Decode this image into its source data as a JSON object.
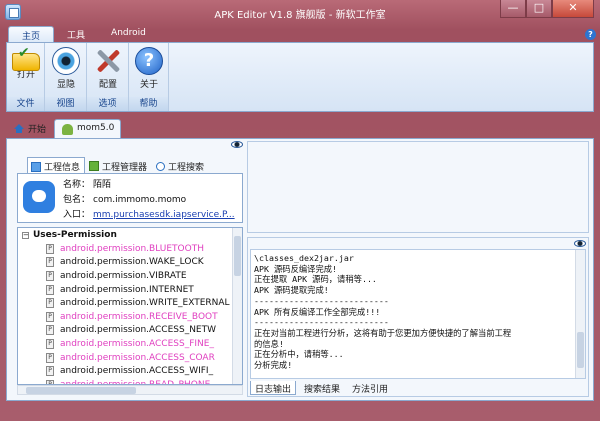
{
  "window": {
    "title": "APK Editor V1.8 旗舰版 - 新软工作室",
    "min": "—",
    "max": "□",
    "close": "✕"
  },
  "ribbon_tabs": [
    "主页",
    "工具",
    "Android"
  ],
  "help": "?",
  "ribbon": {
    "groups": [
      {
        "label": "文件",
        "buttons": [
          {
            "label": "打开",
            "icon": "folder-open-icon"
          }
        ]
      },
      {
        "label": "视图",
        "buttons": [
          {
            "label": "显隐",
            "icon": "eye-icon"
          }
        ]
      },
      {
        "label": "选项",
        "buttons": [
          {
            "label": "配置",
            "icon": "tools-icon"
          }
        ]
      },
      {
        "label": "帮助",
        "buttons": [
          {
            "label": "关于",
            "icon": "help-icon"
          }
        ]
      }
    ]
  },
  "doc_tabs": {
    "start": "开始",
    "active": "mom5.0"
  },
  "left_tabs": [
    "工程信息",
    "工程管理器",
    "工程搜索"
  ],
  "app_info": {
    "name_label": "名称：",
    "name": "陌陌",
    "package_label": "包名：",
    "package": "com.immomo.momo",
    "entry_label": "入口：",
    "entry": "mm.purchasesdk.iapservice.P..."
  },
  "permissions": {
    "header": "Uses-Permission",
    "items": [
      {
        "text": "android.permission.BLUETOOTH",
        "highlight": true
      },
      {
        "text": "android.permission.WAKE_LOCK",
        "highlight": false
      },
      {
        "text": "android.permission.VIBRATE",
        "highlight": false
      },
      {
        "text": "android.permission.INTERNET",
        "highlight": false
      },
      {
        "text": "android.permission.WRITE_EXTERNAL",
        "highlight": false
      },
      {
        "text": "android.permission.RECEIVE_BOOT",
        "highlight": true
      },
      {
        "text": "android.permission.ACCESS_NETW",
        "highlight": false
      },
      {
        "text": "android.permission.ACCESS_FINE_",
        "highlight": true
      },
      {
        "text": "android.permission.ACCESS_COAR",
        "highlight": true
      },
      {
        "text": "android.permission.ACCESS_WIFI_",
        "highlight": false
      },
      {
        "text": "android.permission.READ_PHONE",
        "highlight": true
      }
    ]
  },
  "log": {
    "lines": [
      "\\classes_dex2jar.jar",
      "APK 源码反编译完成!",
      "正在提取 APK 源码，请稍等...",
      "APK 源码提取完成!",
      "---------------------------",
      "APK 所有反编译工作全部完成!!!",
      "---------------------------",
      "正在对当前工程进行分析，这将有助于您更加方便快捷的了解当前工程",
      "的信息!",
      "正在分析中，请稍等...",
      "分析完成!"
    ]
  },
  "bottom_tabs": [
    "日志输出",
    "搜索结果",
    "方法引用"
  ]
}
